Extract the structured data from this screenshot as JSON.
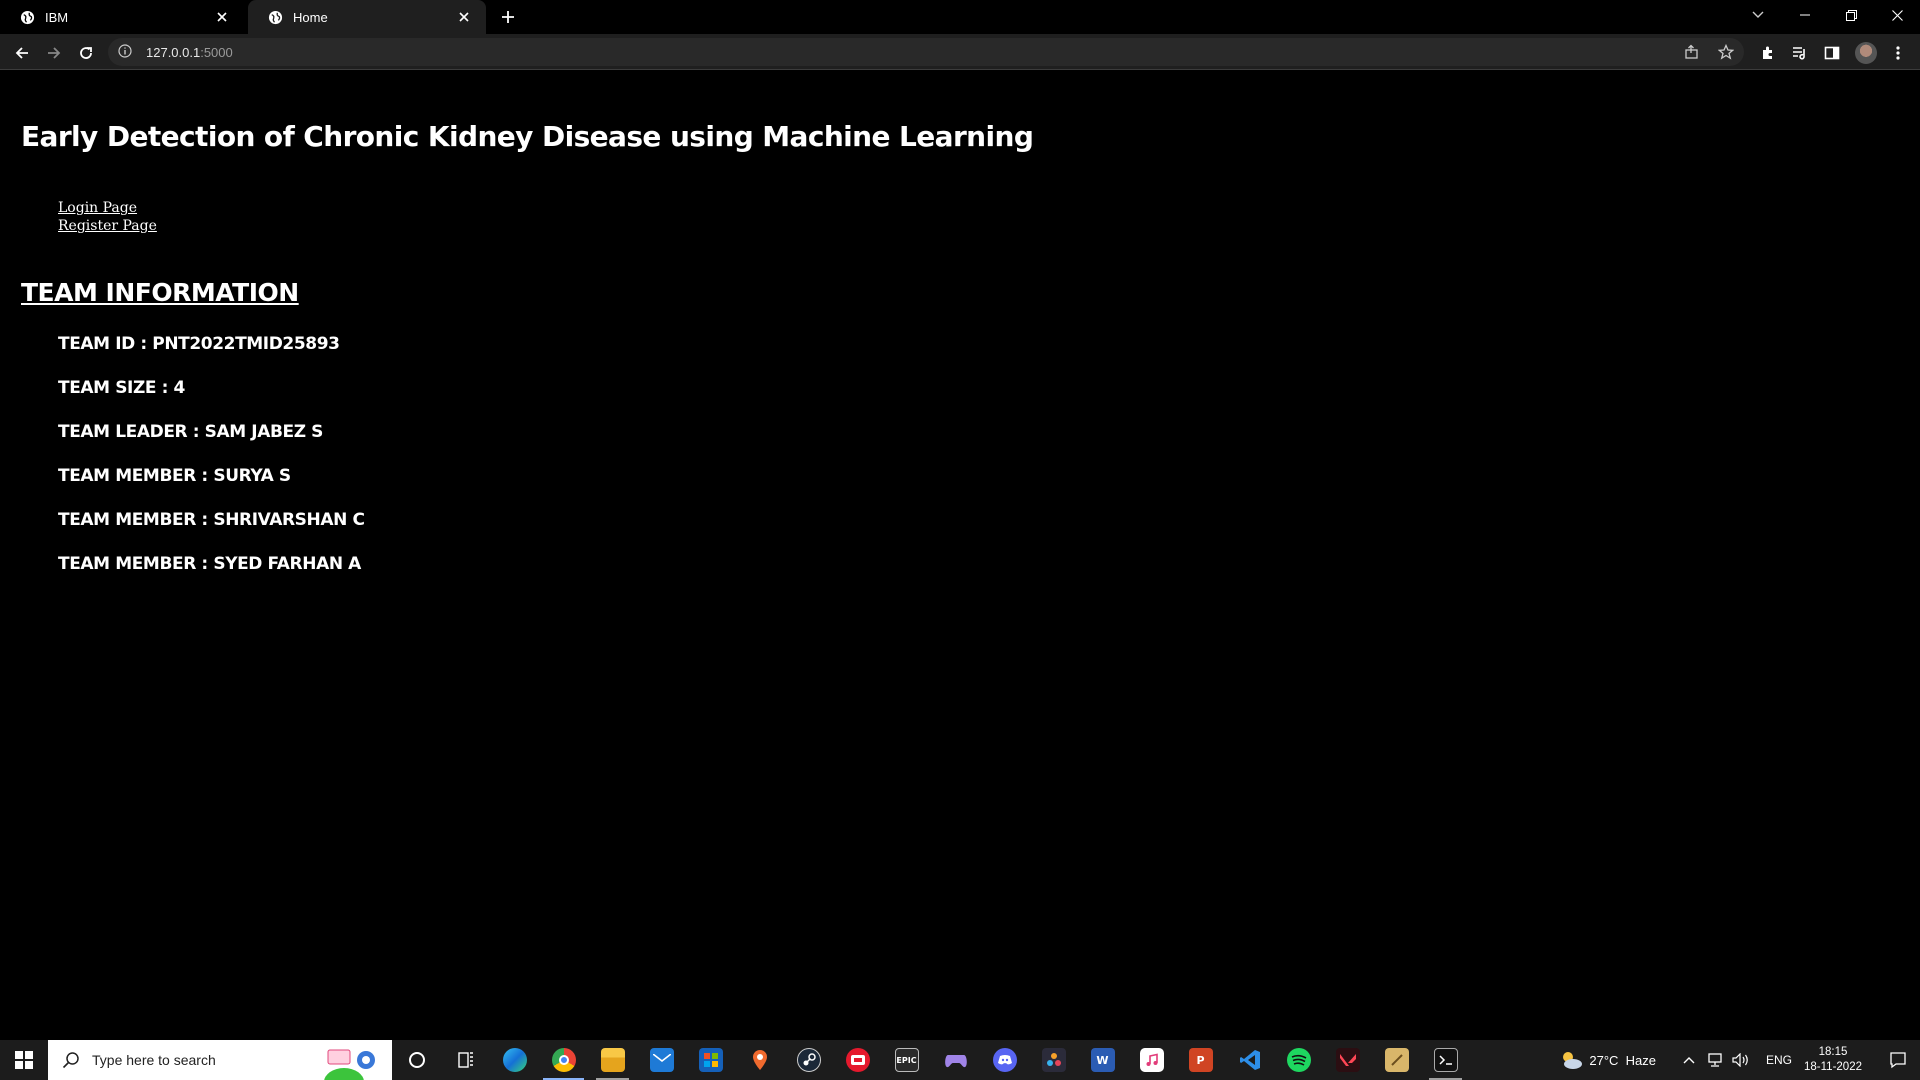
{
  "browser": {
    "tabs": [
      {
        "title": "IBM",
        "active": false
      },
      {
        "title": "Home",
        "active": true
      }
    ],
    "url_host": "127.0.0.1",
    "url_port": ":5000"
  },
  "page": {
    "heading": "Early Detection of Chronic Kidney Disease using Machine Learning",
    "links": {
      "login": "Login Page",
      "register": "Register Page"
    },
    "team_title": "TEAM INFORMATION",
    "team_items": [
      "TEAM ID : PNT2022TMID25893",
      "TEAM SIZE : 4",
      "TEAM LEADER : SAM JABEZ S",
      "TEAM MEMBER : SURYA S",
      "TEAM MEMBER : SHRIVARSHAN C",
      "TEAM MEMBER : SYED FARHAN A"
    ]
  },
  "taskbar": {
    "search_placeholder": "Type here to search",
    "weather_temp": "27°C",
    "weather_desc": "Haze",
    "language": "ENG",
    "time": "18:15",
    "date": "18-11-2022",
    "apps": [
      "cortana-icon",
      "task-view-icon",
      "edge-icon",
      "chrome-icon",
      "file-explorer-icon",
      "mail-icon",
      "store-icon",
      "maps-icon",
      "steam-icon",
      "app-red-icon",
      "epic-games-icon",
      "game-controller-icon",
      "discord-icon",
      "davinci-resolve-icon",
      "word-icon",
      "itunes-icon",
      "powerpoint-icon",
      "vscode-icon",
      "spotify-icon",
      "valorant-icon",
      "notes-icon",
      "terminal-icon"
    ]
  },
  "colors": {
    "page_bg": "#000000",
    "text": "#ffffff",
    "chrome_toolbar": "#1f1f1f",
    "taskbar": "#1c1c1c"
  }
}
